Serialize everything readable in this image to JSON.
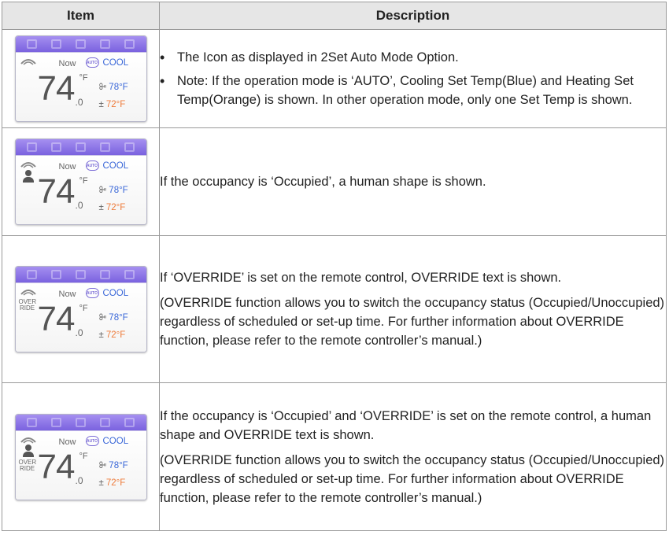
{
  "table": {
    "headers": [
      "Item",
      "Description"
    ],
    "rows": [
      {
        "bullets": [
          "The Icon as displayed in 2Set Auto Mode Option.",
          "Note: If the operation mode is ‘AUTO’, Cooling Set Temp(Blue) and Heating Set Temp(Orange) is shown. In other operation mode, only one Set Temp is shown."
        ]
      },
      {
        "paragraphs": [
          "If the occupancy is ‘Occupied’, a human shape is shown."
        ]
      },
      {
        "paragraphs": [
          "If ‘OVERRIDE’ is set on the remote control, OVERRIDE text is shown.",
          "(OVERRIDE function allows you to switch the occupancy status (Occupied/Unoccupied) regardless of scheduled or set-up time. For further information about OVERRIDE function, please refer to the remote controller’s manual.)"
        ]
      },
      {
        "paragraphs": [
          "If the occupancy is ‘Occupied’ and ‘OVERRIDE’ is set on the remote control, a human shape and OVERRIDE text is shown.",
          "(OVERRIDE function allows you to switch the occupancy status (Occupied/Unoccupied) regardless of scheduled or set-up time. For further information about OVERRIDE function, please refer to the remote controller’s manual.)"
        ]
      }
    ]
  },
  "widget": {
    "now_label": "Now",
    "auto_badge": "AUTO",
    "mode": "COOL",
    "temp_whole": "74",
    "temp_decimal": ".0",
    "temp_unit": "°F",
    "cool_set": "78°F",
    "heat_set": "72°F",
    "override_line1": "OVER",
    "override_line2": "RIDE",
    "colors": {
      "bar": "#8a73e6",
      "cool": "#3a67d8",
      "heat": "#ee7b3b"
    },
    "icons": [
      "fan-icon",
      "person-icon",
      "auto-icon"
    ]
  }
}
